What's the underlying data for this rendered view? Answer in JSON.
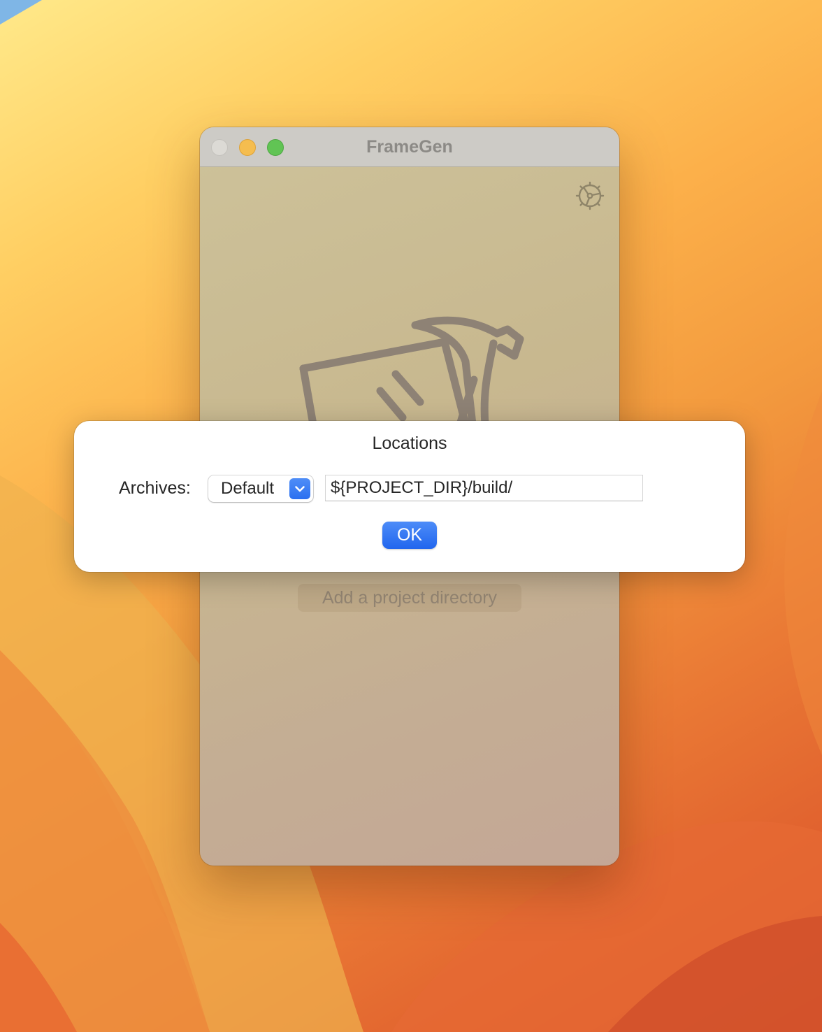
{
  "window": {
    "title": "FrameGen",
    "add_project_label": "Add a project directory"
  },
  "dialog": {
    "title": "Locations",
    "archives_label": "Archives:",
    "location_mode": "Default",
    "path_value": "${PROJECT_DIR}/build/",
    "ok_label": "OK"
  },
  "icons": {
    "settings": "gear-icon",
    "popup_indicator": "chevron-down-icon",
    "app_logo": "app-logo-icon"
  },
  "colors": {
    "accent": "#2a6ff0",
    "traffic_minimize": "#f5bd4f",
    "traffic_zoom": "#61c454"
  }
}
